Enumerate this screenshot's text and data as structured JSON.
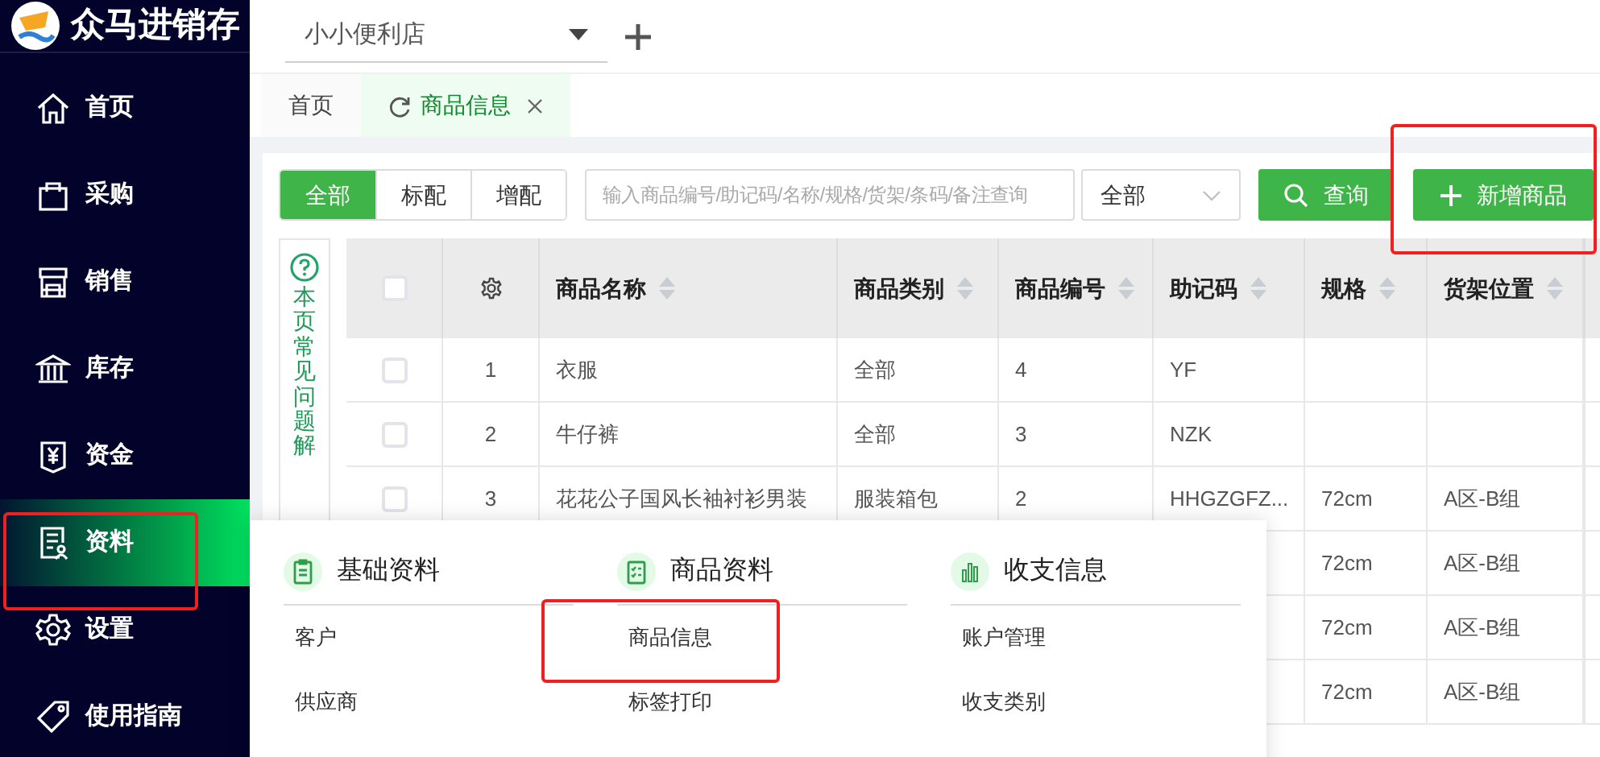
{
  "app": {
    "logo_text": "众马进销存"
  },
  "sidebar": {
    "items": [
      {
        "label": "首页",
        "selected": false
      },
      {
        "label": "采购",
        "selected": false
      },
      {
        "label": "销售",
        "selected": false
      },
      {
        "label": "库存",
        "selected": false
      },
      {
        "label": "资金",
        "selected": false
      },
      {
        "label": "资料",
        "selected": true
      },
      {
        "label": "设置",
        "selected": false
      },
      {
        "label": "使用指南",
        "selected": false
      }
    ]
  },
  "store_select": {
    "value": "小小便利店"
  },
  "tabs": [
    {
      "label": "首页",
      "selected": false
    },
    {
      "label": "商品信息",
      "selected": true
    }
  ],
  "toolbar": {
    "segments": [
      {
        "label": "全部",
        "selected": true
      },
      {
        "label": "标配",
        "selected": false
      },
      {
        "label": "增配",
        "selected": false
      }
    ],
    "search": {
      "placeholder": "输入商品编号/助记码/名称/规格/货架/条码/备注查询"
    },
    "category_select": {
      "value": "全部"
    },
    "buttons": [
      "查询",
      "新增商品"
    ]
  },
  "faq": {
    "text": "本页常见问题解"
  },
  "table": {
    "header_checked": false,
    "columns": [
      "商品名称",
      "商品类别",
      "商品编号",
      "助记码",
      "规格",
      "货架位置"
    ],
    "rows": [
      {
        "checked": false,
        "index": "1",
        "name": "衣服",
        "category": "全部",
        "code": "4",
        "mnemonic": "YF"
      },
      {
        "checked": false,
        "index": "2",
        "name": "牛仔裤",
        "category": "全部",
        "code": "3",
        "mnemonic": "NZK"
      },
      {
        "checked": false,
        "index": "3",
        "name": "花花公子国风长袖衬衫男装",
        "category": "服装箱包",
        "code": "2",
        "mnemonic": "HHGZGFZ...",
        "spec": "72cm",
        "shelf": "A区-B组"
      },
      {
        "spec": "72cm",
        "shelf": "A区-B组"
      },
      {
        "spec": "72cm",
        "shelf": "A区-B组"
      },
      {
        "spec": "72cm",
        "shelf": "A区-B组"
      }
    ]
  },
  "menu": {
    "groups": [
      {
        "title": "基础资料",
        "items": [
          "客户",
          "供应商"
        ]
      },
      {
        "title": "商品资料",
        "items": [
          "商品信息",
          "标签打印"
        ]
      },
      {
        "title": "收支信息",
        "items": [
          "账户管理",
          "收支类别"
        ]
      }
    ]
  }
}
